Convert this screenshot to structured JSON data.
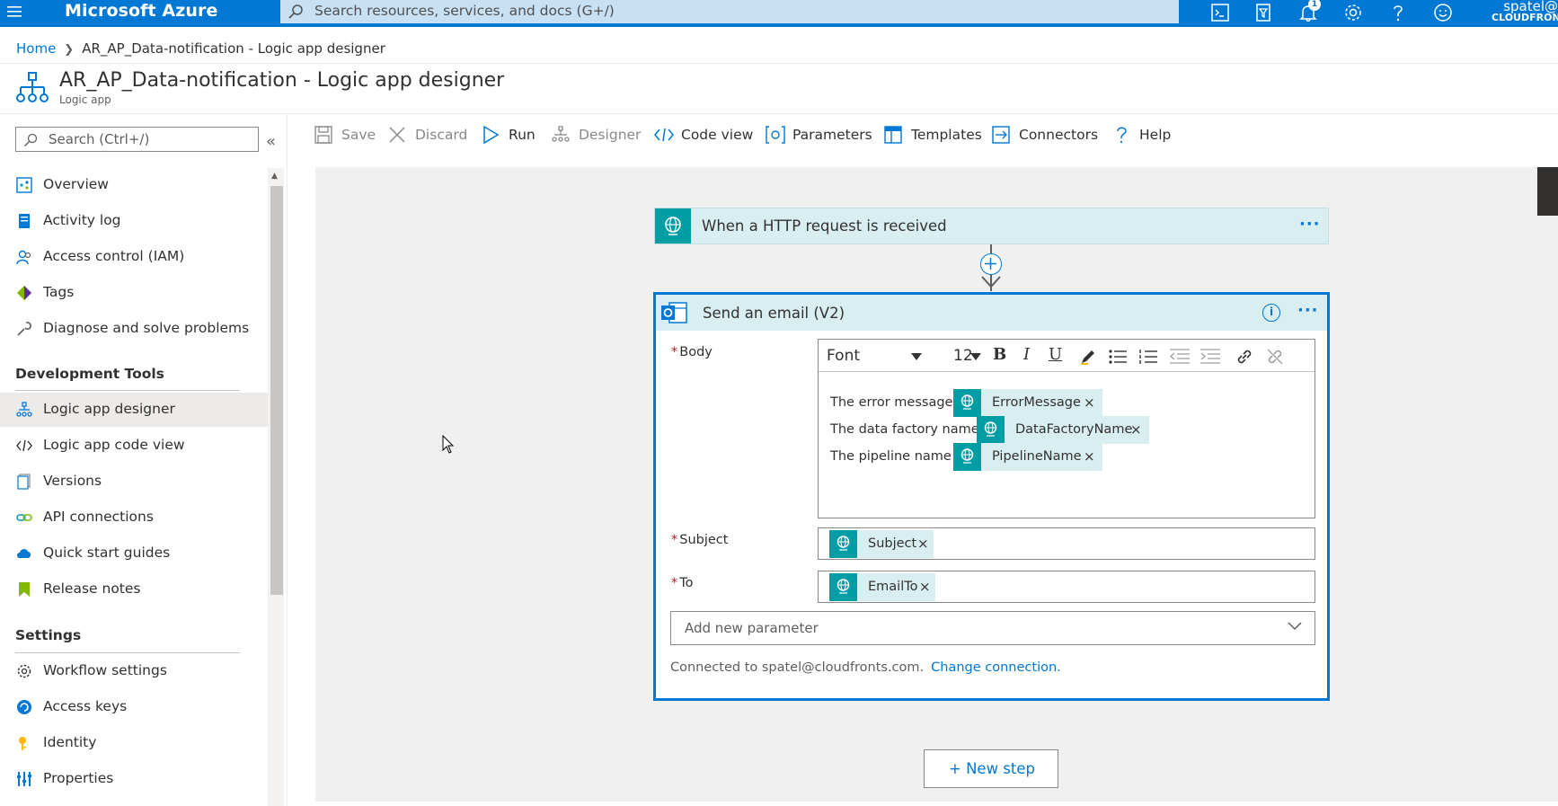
{
  "topbar": {
    "brand": "Microsoft Azure",
    "search_placeholder": "Search resources, services, and docs (G+/)",
    "notification_count": "1",
    "user_line1": "spatel@",
    "user_line2": "CLOUDFRON",
    "color": "#0078d4"
  },
  "breadcrumb": {
    "home": "Home",
    "current": "AR_AP_Data-notification - Logic app designer"
  },
  "page": {
    "title": "AR_AP_Data-notification - Logic app designer",
    "subtitle": "Logic app"
  },
  "sidebar": {
    "search_placeholder": "Search (Ctrl+/)",
    "collapse_label": "«",
    "items": [
      {
        "label": "Overview",
        "icon": "overview-icon"
      },
      {
        "label": "Activity log",
        "icon": "activity-log-icon"
      },
      {
        "label": "Access control (IAM)",
        "icon": "people-icon"
      },
      {
        "label": "Tags",
        "icon": "tag-icon"
      },
      {
        "label": "Diagnose and solve problems",
        "icon": "wrench-icon"
      }
    ],
    "section_dev": "Development Tools",
    "dev_items": [
      {
        "label": "Logic app designer",
        "icon": "designer-icon",
        "active": true
      },
      {
        "label": "Logic app code view",
        "icon": "code-icon"
      },
      {
        "label": "Versions",
        "icon": "versions-icon"
      },
      {
        "label": "API connections",
        "icon": "link-icon"
      },
      {
        "label": "Quick start guides",
        "icon": "cloud-icon"
      },
      {
        "label": "Release notes",
        "icon": "bookmark-icon"
      }
    ],
    "section_settings": "Settings",
    "settings_items": [
      {
        "label": "Workflow settings",
        "icon": "gear-icon"
      },
      {
        "label": "Access keys",
        "icon": "key-refresh-icon"
      },
      {
        "label": "Identity",
        "icon": "identity-icon"
      },
      {
        "label": "Properties",
        "icon": "properties-icon"
      }
    ]
  },
  "toolbar": {
    "save": "Save",
    "discard": "Discard",
    "run": "Run",
    "designer": "Designer",
    "code_view": "Code view",
    "parameters": "Parameters",
    "templates": "Templates",
    "connectors": "Connectors",
    "help": "Help"
  },
  "designer": {
    "trigger_name": "When a HTTP request is received",
    "action_name": "Send an email (V2)",
    "body_label": "Body",
    "editor": {
      "font": "Font",
      "size": "12",
      "lines": [
        {
          "text": "The error message :",
          "token": "ErrorMessage"
        },
        {
          "text": "The data factory name :",
          "token": "DataFactoryName"
        },
        {
          "text": "The pipeline name :",
          "token": "PipelineName"
        }
      ]
    },
    "subject_label": "Subject",
    "subject_token": "Subject",
    "to_label": "To",
    "to_token": "EmailTo",
    "add_param_placeholder": "Add new parameter",
    "connected_text": "Connected to spatel@cloudfronts.com.",
    "change_connection": "Change connection.",
    "new_step": "+ New step",
    "token_remove": "×",
    "required_mark": "*",
    "more": "···",
    "info": "i"
  }
}
